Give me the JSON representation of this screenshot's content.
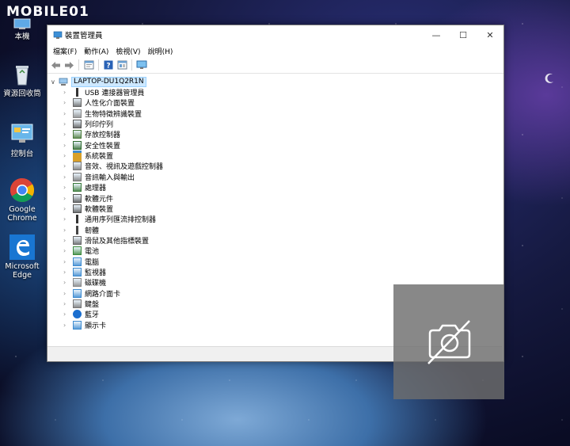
{
  "watermark": {
    "text": "MOBILE",
    "suffix": "01"
  },
  "desktop_icons": [
    {
      "label": "本機",
      "icon": "this-pc-icon"
    },
    {
      "label": "資源回收筒",
      "icon": "recycle-bin-icon"
    },
    {
      "label": "控制台",
      "icon": "control-panel-icon"
    },
    {
      "label": "Google\nChrome",
      "label_line1": "Google",
      "label_line2": "Chrome",
      "icon": "chrome-icon"
    },
    {
      "label_line1": "Microsoft",
      "label_line2": "Edge",
      "icon": "edge-icon"
    }
  ],
  "window": {
    "title": "裝置管理員",
    "controls": {
      "minimize": "—",
      "maximize": "☐",
      "close": "✕"
    },
    "menu": [
      "檔案(F)",
      "動作(A)",
      "檢視(V)",
      "說明(H)"
    ],
    "toolbar_icons": [
      "back-arrow-icon",
      "forward-arrow-icon",
      "properties-icon",
      "help-icon",
      "view-icon",
      "monitor-scan-icon"
    ],
    "tree": {
      "root": "LAPTOP-DU1Q2R1N",
      "items": [
        {
          "label": "USB 連接器管理員",
          "icon": "usb-icon"
        },
        {
          "label": "人性化介面裝置",
          "icon": "hid-icon"
        },
        {
          "label": "生物特徵辨識裝置",
          "icon": "biometric-icon"
        },
        {
          "label": "列印佇列",
          "icon": "printer-icon"
        },
        {
          "label": "存放控制器",
          "icon": "storage-controller-icon"
        },
        {
          "label": "安全性裝置",
          "icon": "security-icon"
        },
        {
          "label": "系統裝置",
          "icon": "system-folder-icon"
        },
        {
          "label": "音效、視訊及遊戲控制器",
          "icon": "speaker-icon"
        },
        {
          "label": "音訊輸入與輸出",
          "icon": "audio-io-icon"
        },
        {
          "label": "處理器",
          "icon": "processor-icon"
        },
        {
          "label": "軟體元件",
          "icon": "software-component-icon"
        },
        {
          "label": "軟體裝置",
          "icon": "software-device-icon"
        },
        {
          "label": "通用序列匯流排控制器",
          "icon": "usb-controller-icon"
        },
        {
          "label": "韌體",
          "icon": "firmware-icon"
        },
        {
          "label": "滑鼠及其他指標裝置",
          "icon": "mouse-icon"
        },
        {
          "label": "電池",
          "icon": "battery-icon"
        },
        {
          "label": "電腦",
          "icon": "computer-icon"
        },
        {
          "label": "監視器",
          "icon": "monitor-icon"
        },
        {
          "label": "磁碟機",
          "icon": "disk-drive-icon"
        },
        {
          "label": "網路介面卡",
          "icon": "network-adapter-icon"
        },
        {
          "label": "鍵盤",
          "icon": "keyboard-icon"
        },
        {
          "label": "藍牙",
          "icon": "bluetooth-icon"
        },
        {
          "label": "顯示卡",
          "icon": "display-adapter-icon"
        }
      ]
    }
  },
  "overlay": {
    "icon": "camera-off-icon"
  }
}
